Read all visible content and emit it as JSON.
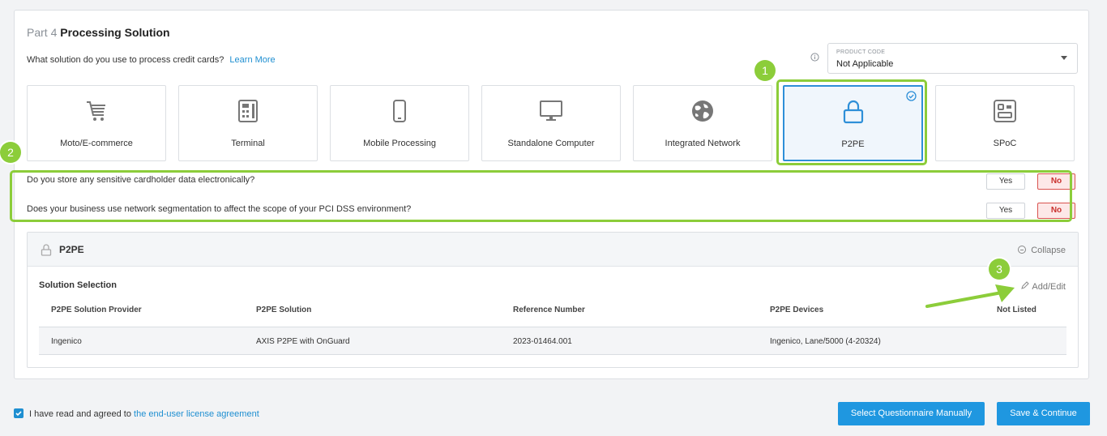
{
  "header": {
    "part_label": "Part 4",
    "title": "Processing Solution",
    "question": "What solution do you use to process credit cards?",
    "learn_more": "Learn More"
  },
  "product_code": {
    "label": "PRODUCT CODE",
    "value": "Not Applicable"
  },
  "solutions": [
    {
      "label": "Moto/E-commerce",
      "icon": "cart-icon"
    },
    {
      "label": "Terminal",
      "icon": "calculator-icon"
    },
    {
      "label": "Mobile Processing",
      "icon": "mobile-icon"
    },
    {
      "label": "Standalone Computer",
      "icon": "monitor-icon"
    },
    {
      "label": "Integrated Network",
      "icon": "globe-icon"
    },
    {
      "label": "P2PE",
      "icon": "lock-icon",
      "selected": true
    },
    {
      "label": "SPoC",
      "icon": "card-reader-icon"
    }
  ],
  "questions": [
    {
      "text": "Do you store any sensitive cardholder data electronically?",
      "yes": "Yes",
      "no": "No",
      "selected": "No"
    },
    {
      "text": "Does your business use network segmentation to affect the scope of your PCI DSS environment?",
      "yes": "Yes",
      "no": "No",
      "selected": "No"
    }
  ],
  "panel": {
    "title": "P2PE",
    "collapse": "Collapse",
    "solution_selection": "Solution Selection",
    "add_edit": "Add/Edit",
    "columns": [
      "P2PE Solution Provider",
      "P2PE Solution",
      "Reference Number",
      "P2PE Devices",
      "Not Listed"
    ],
    "rows": [
      {
        "provider": "Ingenico",
        "solution": "AXIS P2PE with OnGuard",
        "reference": "2023-01464.001",
        "devices": "Ingenico, Lane/5000 (4-20324)",
        "not_listed": ""
      }
    ]
  },
  "annotations": {
    "badge1": "1",
    "badge2": "2",
    "badge3": "3",
    "highlight_color": "#8ccd3a"
  },
  "footer": {
    "agree_text": "I have read and agreed to ",
    "agree_link": "the end-user license agreement",
    "btn_manual": "Select Questionnaire Manually",
    "btn_save": "Save & Continue"
  },
  "colors": {
    "accent": "#1f97e0",
    "no_red": "#d9534f"
  }
}
